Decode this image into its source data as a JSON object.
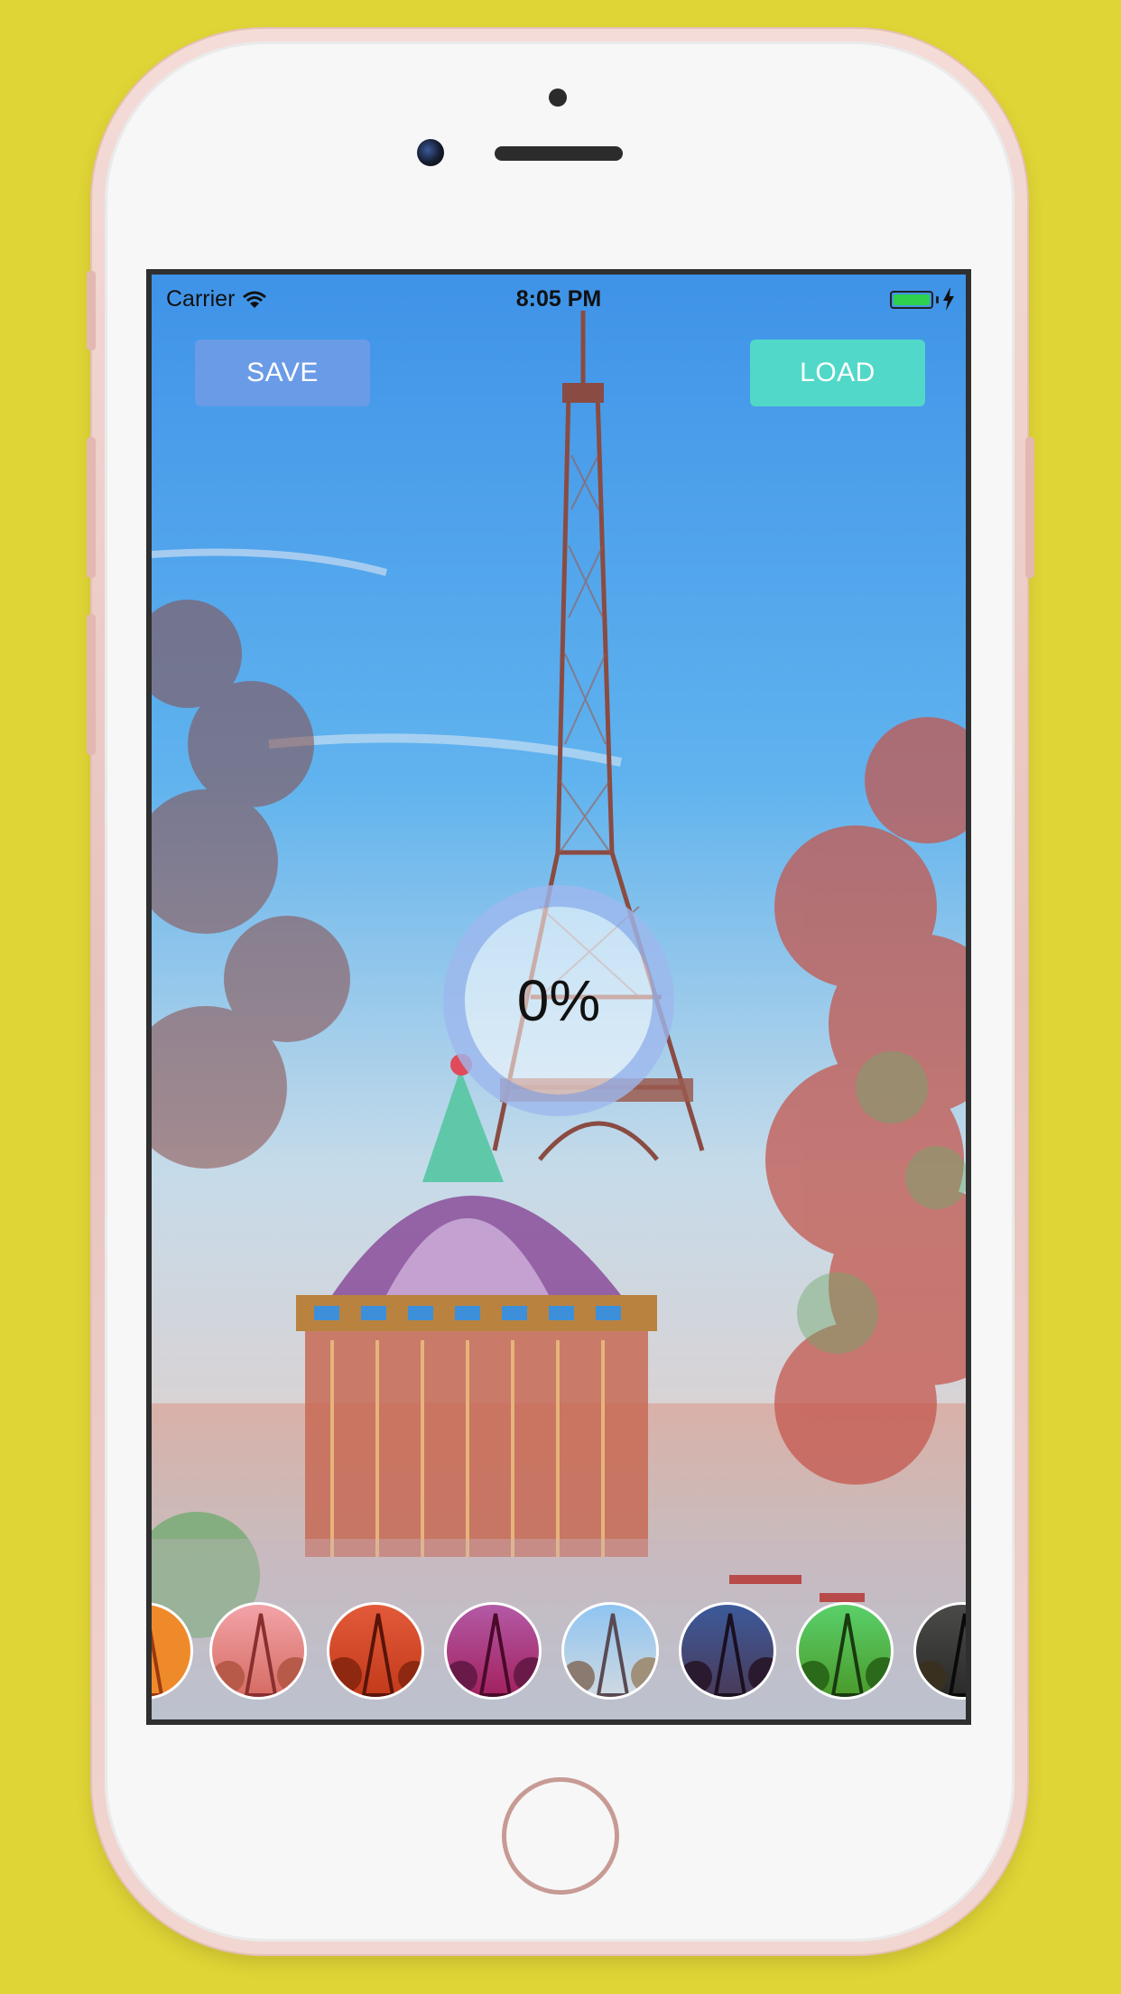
{
  "status_bar": {
    "carrier": "Carrier",
    "time": "8:05 PM"
  },
  "toolbar": {
    "save_label": "SAVE",
    "load_label": "LOAD"
  },
  "progress": {
    "label": "0%",
    "value": 0
  },
  "filters": [
    {
      "name": "orange"
    },
    {
      "name": "warm-pink"
    },
    {
      "name": "red"
    },
    {
      "name": "magenta"
    },
    {
      "name": "light-blue"
    },
    {
      "name": "dark-blue"
    },
    {
      "name": "green"
    },
    {
      "name": "dark"
    }
  ],
  "colors": {
    "background": "#E0D536",
    "save_button": "#6A9BE6",
    "load_button": "#52D8C8",
    "ring": "#9DB8EE",
    "phone_frame": "#EFCFC9"
  }
}
